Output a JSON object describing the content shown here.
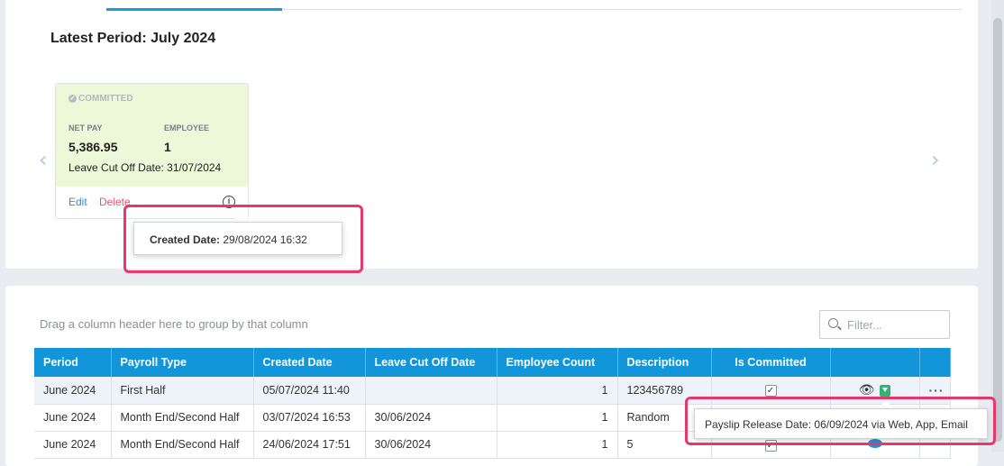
{
  "latest": {
    "title": "Latest Period: July 2024",
    "status": "COMMITTED",
    "net_pay_label": "NET PAY",
    "net_pay": "5,386.95",
    "employee_label": "EMPLOYEE",
    "employee_count": "1",
    "leave_cutoff": "Leave Cut Off Date: 31/07/2024",
    "edit_label": "Edit",
    "delete_label": "Delete",
    "info_icon": "i",
    "prev_arrow": "‹",
    "next_arrow": "›"
  },
  "created_tooltip": {
    "label": "Created Date:",
    "value": "29/08/2024 16:32"
  },
  "grid": {
    "group_hint": "Drag a column header here to group by that column",
    "filter_placeholder": "Filter...",
    "columns": [
      "Period",
      "Payroll Type",
      "Created Date",
      "Leave Cut Off Date",
      "Employee Count",
      "Description",
      "Is Committed",
      "",
      ""
    ],
    "rows": [
      {
        "period": "June 2024",
        "type": "First Half",
        "created": "05/07/2024 11:40",
        "cutoff": "",
        "count": "1",
        "description": "123456789",
        "committed": "✓"
      },
      {
        "period": "June 2024",
        "type": "Month End/Second Half",
        "created": "03/07/2024 16:53",
        "cutoff": "30/06/2024",
        "count": "1",
        "description": "Random",
        "committed": "✓"
      },
      {
        "period": "June 2024",
        "type": "Month End/Second Half",
        "created": "24/06/2024 17:51",
        "cutoff": "30/06/2024",
        "count": "1",
        "description": "5",
        "committed": "✓"
      }
    ],
    "eye_icon": "👁",
    "more_icon": "···"
  },
  "payslip_tooltip": {
    "label": "Payslip Release Date:",
    "value": "06/09/2024 via Web, App, Email"
  },
  "colors": {
    "accent": "#1296d9",
    "highlight": "#e8386a",
    "committed_bg": "#ecf8d7",
    "delete": "#e8566e"
  }
}
